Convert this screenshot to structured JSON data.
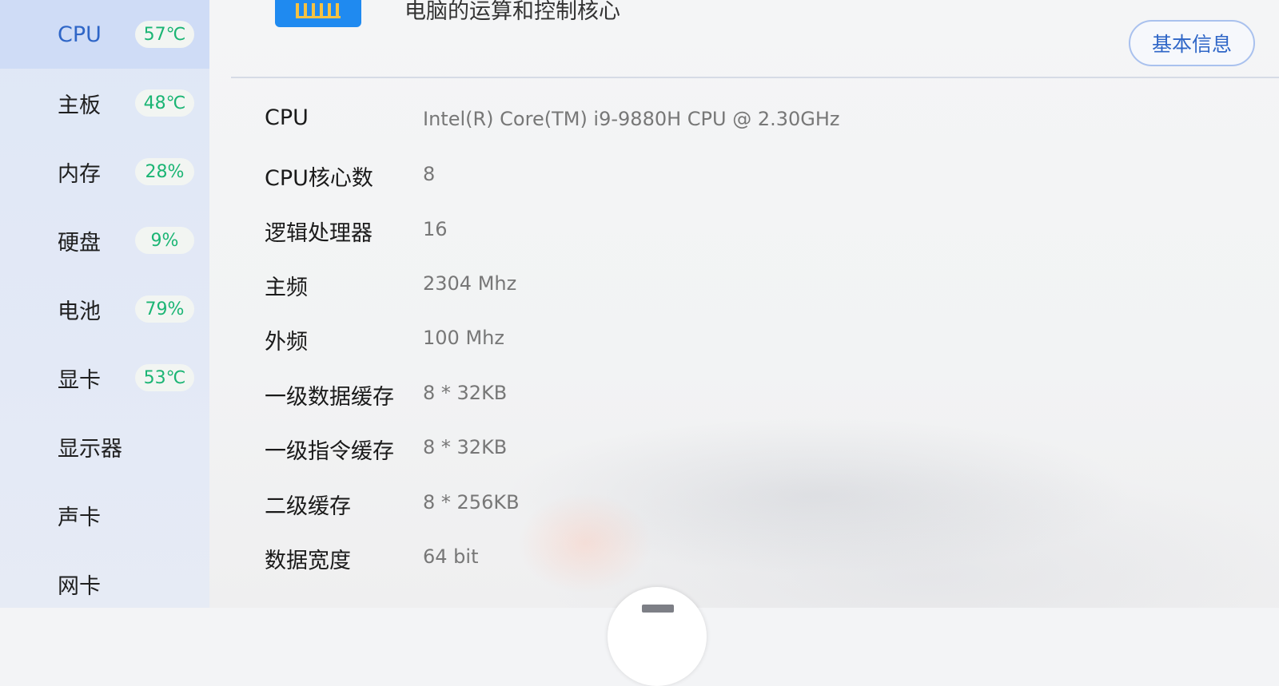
{
  "sidebar": {
    "items": [
      {
        "label": "CPU",
        "badge": "57℃",
        "active": true
      },
      {
        "label": "主板",
        "badge": "48℃"
      },
      {
        "label": "内存",
        "badge": "28%"
      },
      {
        "label": "硬盘",
        "badge": "9%"
      },
      {
        "label": "电池",
        "badge": "79%"
      },
      {
        "label": "显卡",
        "badge": "53℃"
      },
      {
        "label": "显示器"
      },
      {
        "label": "声卡"
      },
      {
        "label": "网卡"
      }
    ]
  },
  "header": {
    "subtitle": "电脑的运算和控制核心",
    "button_label": "基本信息",
    "icon": "cpu-chip-icon"
  },
  "specs": [
    {
      "key": "CPU",
      "value": "Intel(R) Core(TM) i9-9880H CPU @ 2.30GHz"
    },
    {
      "key": "CPU核心数",
      "value": "8"
    },
    {
      "key": "逻辑处理器",
      "value": "16"
    },
    {
      "key": "主频",
      "value": "2304 Mhz"
    },
    {
      "key": "外频",
      "value": "100 Mhz"
    },
    {
      "key": "一级数据缓存",
      "value": "8 * 32KB"
    },
    {
      "key": "一级指令缓存",
      "value": "8 * 32KB"
    },
    {
      "key": "二级缓存",
      "value": "8 * 256KB"
    },
    {
      "key": "数据宽度",
      "value": "64 bit"
    }
  ],
  "colors": {
    "accent": "#2f66c7",
    "badge_text": "#1bb574",
    "active_bg": "#cfdcf6"
  }
}
